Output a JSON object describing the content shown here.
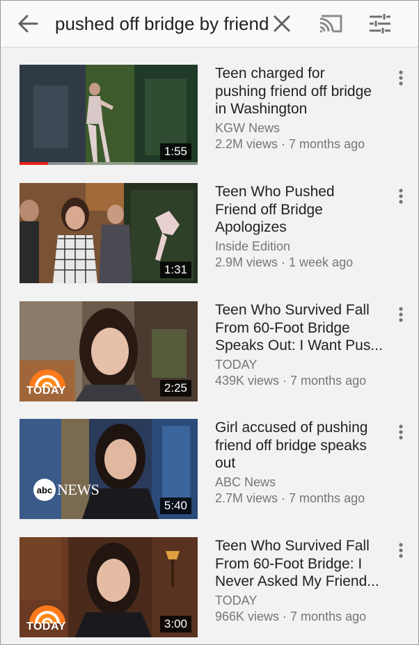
{
  "search": {
    "query": "pushed off bridge by friend"
  },
  "icons": {
    "back": "arrow-left-icon",
    "clear": "close-icon",
    "cast": "cast-icon",
    "filter": "filter-sliders-icon",
    "more": "more-vertical-icon"
  },
  "colors": {
    "progress": "#e62117",
    "secondary_text": "#767676"
  },
  "results": [
    {
      "title_lines": [
        "Teen charged for",
        "pushing friend off bridge",
        "in Washington"
      ],
      "channel": "KGW News",
      "meta": "2.2M views · 7 months ago",
      "duration": "1:55",
      "watched_fraction": 0.16
    },
    {
      "title_lines": [
        "Teen Who Pushed",
        "Friend off Bridge",
        "Apologizes"
      ],
      "channel": "Inside Edition",
      "meta": "2.9M views · 1 week ago",
      "duration": "1:31"
    },
    {
      "title_lines": [
        "Teen Who Survived Fall",
        "From 60-Foot Bridge",
        "Speaks Out: I Want Pus..."
      ],
      "channel": "TODAY",
      "meta": "439K views · 7 months ago",
      "duration": "2:25",
      "logo": "TODAY"
    },
    {
      "title_lines": [
        "Girl accused of pushing",
        "friend off bridge speaks",
        "out"
      ],
      "channel": "ABC News",
      "meta": "2.7M views · 7 months ago",
      "duration": "5:40",
      "logo": "abc NEWS"
    },
    {
      "title_lines": [
        "Teen Who Survived Fall",
        "From 60-Foot Bridge: I",
        "Never Asked My Friend..."
      ],
      "channel": "TODAY",
      "meta": "966K views · 7 months ago",
      "duration": "3:00",
      "logo": "TODAY"
    }
  ]
}
